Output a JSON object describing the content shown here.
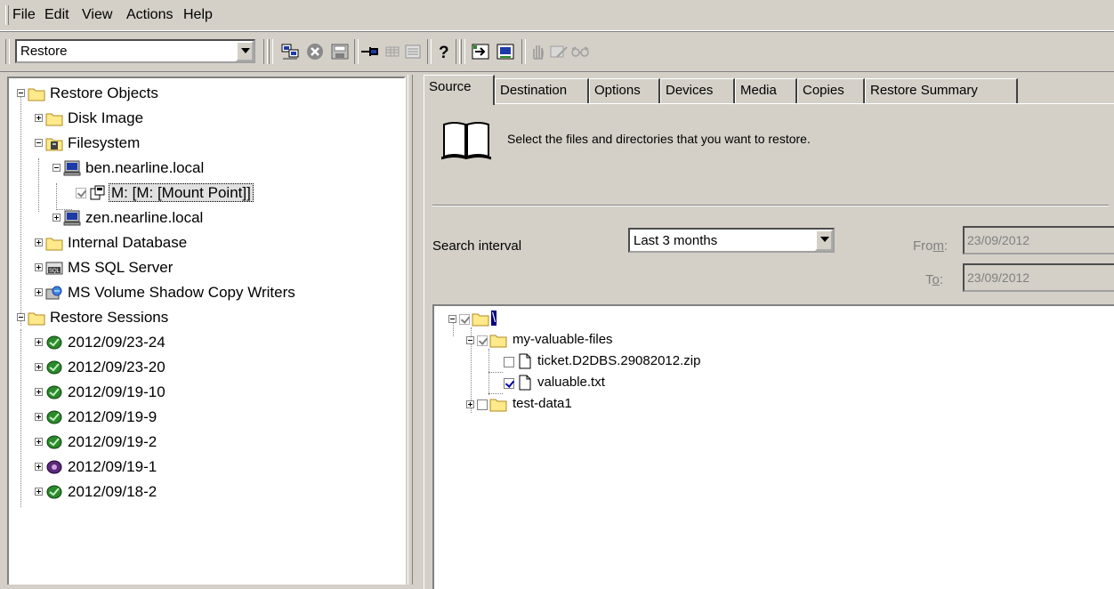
{
  "menu": [
    "File",
    "Edit",
    "View",
    "Actions",
    "Help"
  ],
  "toolbar": {
    "context_value": "Restore",
    "icons": [
      "wizard-icon",
      "stop-icon",
      "save-icon",
      "pin-icon",
      "grid-icon",
      "list-icon",
      "help-icon",
      "restore-all-icon",
      "restore-network-icon",
      "hand-icon",
      "pen-icon",
      "glasses-icon"
    ]
  },
  "left_tree": [
    {
      "label": "Restore Objects",
      "icon": "folder-icon"
    },
    {
      "label": "Disk Image",
      "icon": "folder-icon"
    },
    {
      "label": "Filesystem",
      "icon": "filesystem-icon"
    },
    {
      "label": "ben.nearline.local",
      "icon": "computer-icon"
    },
    {
      "label": "M: [M: [Mount Point]]",
      "icon": "drive-icon"
    },
    {
      "label": "zen.nearline.local",
      "icon": "computer-icon"
    },
    {
      "label": "Internal Database",
      "icon": "folder-icon"
    },
    {
      "label": "MS SQL Server",
      "icon": "sql-icon"
    },
    {
      "label": "MS Volume Shadow Copy Writers",
      "icon": "vss-icon"
    },
    {
      "label": "Restore Sessions",
      "icon": "folder-icon"
    },
    {
      "label": "2012/09/23-24",
      "icon": "session-ok-icon"
    },
    {
      "label": "2012/09/23-20",
      "icon": "session-ok-icon"
    },
    {
      "label": "2012/09/19-10",
      "icon": "session-ok-icon"
    },
    {
      "label": "2012/09/19-9",
      "icon": "session-ok-icon"
    },
    {
      "label": "2012/09/19-2",
      "icon": "session-ok-icon"
    },
    {
      "label": "2012/09/19-1",
      "icon": "session-failed-icon"
    },
    {
      "label": "2012/09/18-2",
      "icon": "session-ok-icon"
    }
  ],
  "tabs": [
    "Source",
    "Destination",
    "Options",
    "Devices",
    "Media",
    "Copies",
    "Restore Summary"
  ],
  "source": {
    "intro": "Select the files and directories that you want to restore.",
    "search_label": "Search interval",
    "interval_value": "Last 3 months",
    "from_label_pre": "Fro",
    "from_label_key": "m",
    "from_label_post": ":",
    "from_value": "23/09/2012",
    "to_label_pre": "T",
    "to_label_key": "o",
    "to_label_post": ":",
    "to_value": "23/09/2012"
  },
  "file_tree": [
    {
      "label": "\\",
      "checked": true
    },
    {
      "label": "my-valuable-files",
      "checked": true
    },
    {
      "label": "ticket.D2DBS.29082012.zip",
      "checked": false
    },
    {
      "label": "valuable.txt",
      "checked": true
    },
    {
      "label": "test-data1",
      "checked": false
    }
  ],
  "colors": {
    "folder": "#ffe98a",
    "session_ok": "#2a8a2a",
    "session_failed": "#5a2a7a",
    "computer": "#1c3aa8"
  }
}
